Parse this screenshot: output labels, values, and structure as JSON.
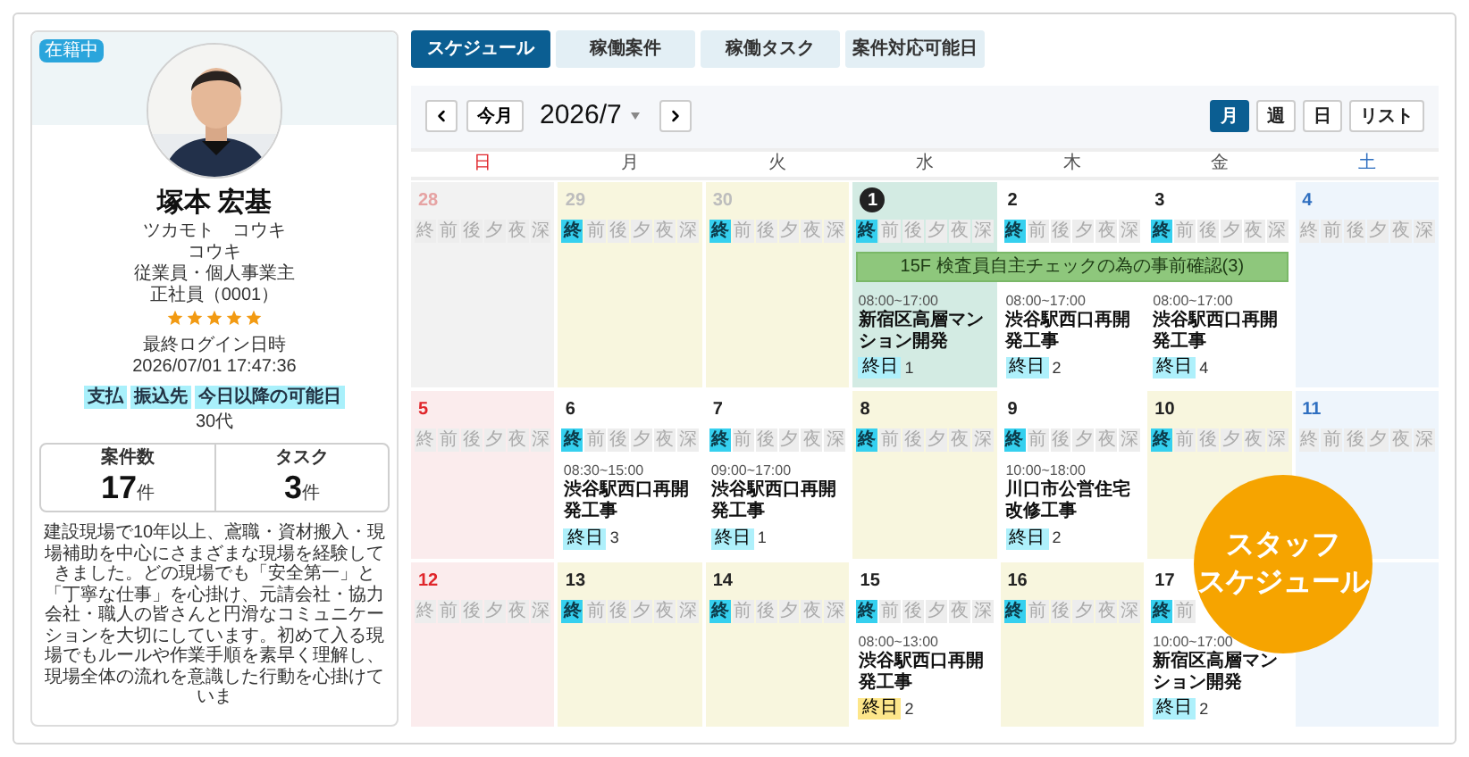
{
  "profile": {
    "status": "在籍中",
    "name": "塚本 宏基",
    "kana": [
      "ツカモト　コウキ",
      "コウキ"
    ],
    "details": [
      "従業員・個人事業主",
      "正社員（0001）"
    ],
    "stars": 5,
    "login_label": "最終ログイン日時",
    "login_time": "2026/07/01 17:47:36",
    "tags": [
      "支払",
      "振込先",
      "今日以降の可能日"
    ],
    "age": "30代",
    "stats": [
      {
        "label": "案件数",
        "value": "17",
        "unit": "件"
      },
      {
        "label": "タスク",
        "value": "3",
        "unit": "件"
      }
    ],
    "description": "建設現場で10年以上、鳶職・資材搬入・現場補助を中心にさまざまな現場を経験してきました。どの現場でも「安全第一」と「丁寧な仕事」を心掛け、元請会社・協力会社・職人の皆さんと円滑なコミュニケーションを大切にしています。初めて入る現場でもルールや作業手順を素早く理解し、現場全体の流れを意識した行動を心掛けていま"
  },
  "tabs": [
    {
      "label": "スケジュール",
      "selected": true
    },
    {
      "label": "稼働案件",
      "selected": false
    },
    {
      "label": "稼働タスク",
      "selected": false
    },
    {
      "label": "案件対応可能日",
      "selected": false
    }
  ],
  "toolbar": {
    "today": "今月",
    "title": "2026/7",
    "views": [
      {
        "label": "月",
        "selected": true
      },
      {
        "label": "週",
        "selected": false
      },
      {
        "label": "日",
        "selected": false
      },
      {
        "label": "リスト",
        "selected": false
      }
    ]
  },
  "weekdays": [
    "日",
    "月",
    "火",
    "水",
    "木",
    "金",
    "土"
  ],
  "weeks": [
    {
      "banner": {
        "text": "15F 検査員自主チェックの為の事前確認(3)"
      },
      "cells": [
        {
          "date": "28",
          "kind": "muted",
          "other_month": true,
          "slots": [
            {
              "label": "終",
              "on": false
            },
            {
              "label": "前",
              "on": false
            },
            {
              "label": "後",
              "on": false
            },
            {
              "label": "夕",
              "on": false
            },
            {
              "label": "夜",
              "on": false
            },
            {
              "label": "深",
              "on": false
            }
          ]
        },
        {
          "date": "29",
          "kind": "available",
          "other_month": true,
          "slots": [
            {
              "label": "終",
              "on": true
            },
            {
              "label": "前",
              "on": false
            },
            {
              "label": "後",
              "on": false
            },
            {
              "label": "夕",
              "on": false
            },
            {
              "label": "夜",
              "on": false
            },
            {
              "label": "深",
              "on": false
            }
          ]
        },
        {
          "date": "30",
          "kind": "available",
          "other_month": true,
          "slots": [
            {
              "label": "終",
              "on": true
            },
            {
              "label": "前",
              "on": false
            },
            {
              "label": "後",
              "on": false
            },
            {
              "label": "夕",
              "on": false
            },
            {
              "label": "夜",
              "on": false
            },
            {
              "label": "深",
              "on": false
            }
          ]
        },
        {
          "date": "1",
          "kind": "today",
          "in_banner": true,
          "slots": [
            {
              "label": "終",
              "on": true
            },
            {
              "label": "前",
              "on": false
            },
            {
              "label": "後",
              "on": false
            },
            {
              "label": "夕",
              "on": false
            },
            {
              "label": "夜",
              "on": false
            },
            {
              "label": "深",
              "on": false
            }
          ],
          "events": [
            {
              "time": "08:00~17:00",
              "title": "新宿区高層マンション開発",
              "tag": "終日",
              "count": "1",
              "color": "#aef0fb"
            }
          ]
        },
        {
          "date": "2",
          "kind": "plain",
          "in_banner": true,
          "slots": [
            {
              "label": "終",
              "on": true
            },
            {
              "label": "前",
              "on": false
            },
            {
              "label": "後",
              "on": false
            },
            {
              "label": "夕",
              "on": false
            },
            {
              "label": "夜",
              "on": false
            },
            {
              "label": "深",
              "on": false
            }
          ],
          "events": [
            {
              "time": "08:00~17:00",
              "title": "渋谷駅西口再開発工事",
              "tag": "終日",
              "count": "2",
              "color": "#aef0fb"
            }
          ]
        },
        {
          "date": "3",
          "kind": "plain",
          "in_banner": true,
          "slots": [
            {
              "label": "終",
              "on": true
            },
            {
              "label": "前",
              "on": false
            },
            {
              "label": "後",
              "on": false
            },
            {
              "label": "夕",
              "on": false
            },
            {
              "label": "夜",
              "on": false
            },
            {
              "label": "深",
              "on": false
            }
          ],
          "events": [
            {
              "time": "08:00~17:00",
              "title": "渋谷駅西口再開発工事",
              "tag": "終日",
              "count": "4",
              "color": "#aef0fb"
            }
          ]
        },
        {
          "date": "4",
          "kind": "saturday",
          "slots": [
            {
              "label": "終",
              "on": false
            },
            {
              "label": "前",
              "on": false
            },
            {
              "label": "後",
              "on": false
            },
            {
              "label": "夕",
              "on": false
            },
            {
              "label": "夜",
              "on": false
            },
            {
              "label": "深",
              "on": false
            }
          ]
        }
      ]
    },
    {
      "cells": [
        {
          "date": "5",
          "kind": "sunday",
          "slots": [
            {
              "label": "終",
              "on": false
            },
            {
              "label": "前",
              "on": false
            },
            {
              "label": "後",
              "on": false
            },
            {
              "label": "夕",
              "on": false
            },
            {
              "label": "夜",
              "on": false
            },
            {
              "label": "深",
              "on": false
            }
          ]
        },
        {
          "date": "6",
          "kind": "plain",
          "slots": [
            {
              "label": "終",
              "on": true
            },
            {
              "label": "前",
              "on": false
            },
            {
              "label": "後",
              "on": false
            },
            {
              "label": "夕",
              "on": false
            },
            {
              "label": "夜",
              "on": false
            },
            {
              "label": "深",
              "on": false
            }
          ],
          "events": [
            {
              "time": "08:30~15:00",
              "title": "渋谷駅西口再開発工事",
              "tag": "終日",
              "count": "3",
              "color": "#aef0fb"
            }
          ]
        },
        {
          "date": "7",
          "kind": "plain",
          "slots": [
            {
              "label": "終",
              "on": true
            },
            {
              "label": "前",
              "on": false
            },
            {
              "label": "後",
              "on": false
            },
            {
              "label": "夕",
              "on": false
            },
            {
              "label": "夜",
              "on": false
            },
            {
              "label": "深",
              "on": false
            }
          ],
          "events": [
            {
              "time": "09:00~17:00",
              "title": "渋谷駅西口再開発工事",
              "tag": "終日",
              "count": "1",
              "color": "#aef0fb"
            }
          ]
        },
        {
          "date": "8",
          "kind": "available",
          "slots": [
            {
              "label": "終",
              "on": true
            },
            {
              "label": "前",
              "on": false
            },
            {
              "label": "後",
              "on": false
            },
            {
              "label": "夕",
              "on": false
            },
            {
              "label": "夜",
              "on": false
            },
            {
              "label": "深",
              "on": false
            }
          ]
        },
        {
          "date": "9",
          "kind": "plain",
          "slots": [
            {
              "label": "終",
              "on": true
            },
            {
              "label": "前",
              "on": false
            },
            {
              "label": "後",
              "on": false
            },
            {
              "label": "夕",
              "on": false
            },
            {
              "label": "夜",
              "on": false
            },
            {
              "label": "深",
              "on": false
            }
          ],
          "events": [
            {
              "time": "10:00~18:00",
              "title": "川口市公営住宅改修工事",
              "tag": "終日",
              "count": "2",
              "color": "#aef0fb"
            }
          ]
        },
        {
          "date": "10",
          "kind": "available",
          "slots": [
            {
              "label": "終",
              "on": true
            },
            {
              "label": "前",
              "on": false
            },
            {
              "label": "後",
              "on": false
            },
            {
              "label": "夕",
              "on": false
            },
            {
              "label": "夜",
              "on": false
            },
            {
              "label": "深",
              "on": false
            }
          ]
        },
        {
          "date": "11",
          "kind": "saturday",
          "slots": [
            {
              "label": "終",
              "on": false
            },
            {
              "label": "前",
              "on": false
            },
            {
              "label": "後",
              "on": false
            },
            {
              "label": "夕",
              "on": false
            },
            {
              "label": "夜",
              "on": false
            },
            {
              "label": "深",
              "on": false
            }
          ]
        }
      ]
    },
    {
      "cells": [
        {
          "date": "12",
          "kind": "sunday",
          "slots": [
            {
              "label": "終",
              "on": false
            },
            {
              "label": "前",
              "on": false
            },
            {
              "label": "後",
              "on": false
            },
            {
              "label": "夕",
              "on": false
            },
            {
              "label": "夜",
              "on": false
            },
            {
              "label": "深",
              "on": false
            }
          ]
        },
        {
          "date": "13",
          "kind": "available",
          "slots": [
            {
              "label": "終",
              "on": true
            },
            {
              "label": "前",
              "on": false
            },
            {
              "label": "後",
              "on": false
            },
            {
              "label": "夕",
              "on": false
            },
            {
              "label": "夜",
              "on": false
            },
            {
              "label": "深",
              "on": false
            }
          ]
        },
        {
          "date": "14",
          "kind": "available",
          "slots": [
            {
              "label": "終",
              "on": true
            },
            {
              "label": "前",
              "on": false
            },
            {
              "label": "後",
              "on": false
            },
            {
              "label": "夕",
              "on": false
            },
            {
              "label": "夜",
              "on": false
            },
            {
              "label": "深",
              "on": false
            }
          ]
        },
        {
          "date": "15",
          "kind": "plain",
          "slots": [
            {
              "label": "終",
              "on": true
            },
            {
              "label": "前",
              "on": false
            },
            {
              "label": "後",
              "on": false
            },
            {
              "label": "夕",
              "on": false
            },
            {
              "label": "夜",
              "on": false
            },
            {
              "label": "深",
              "on": false
            }
          ],
          "events": [
            {
              "time": "08:00~13:00",
              "title": "渋谷駅西口再開発工事",
              "tag": "終日",
              "count": "2",
              "color": "#fde68a"
            }
          ]
        },
        {
          "date": "16",
          "kind": "available",
          "slots": [
            {
              "label": "終",
              "on": true
            },
            {
              "label": "前",
              "on": false
            },
            {
              "label": "後",
              "on": false
            },
            {
              "label": "夕",
              "on": false
            },
            {
              "label": "夜",
              "on": false
            },
            {
              "label": "深",
              "on": false
            }
          ]
        },
        {
          "date": "17",
          "kind": "plain",
          "slots": [
            {
              "label": "終",
              "on": true
            },
            {
              "label": "前",
              "on": false
            }
          ],
          "events": [
            {
              "time": "10:00~17:00",
              "title": "新宿区高層マンション開発",
              "tag": "終日",
              "count": "2",
              "color": "#aef0fb"
            }
          ]
        },
        {
          "kind": "saturday"
        }
      ]
    }
  ],
  "promo_badge": {
    "lines": [
      "スタッフ",
      "スケジュール"
    ]
  }
}
